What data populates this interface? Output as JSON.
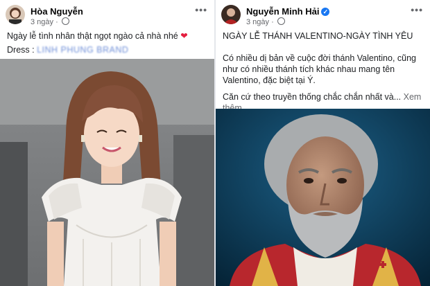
{
  "left_post": {
    "author": "Hòa Nguyễn",
    "time": "3 ngày",
    "visibility_icon": "globe-icon",
    "more_icon": "more-options-icon",
    "caption": "Ngày lễ tình nhân thật ngọt ngào cả nhà nhé",
    "caption_emoji": "❤",
    "dress_label": "Dress :",
    "dress_brand": "LINH PHUNG BRAND"
  },
  "right_post": {
    "author": "Nguyễn Minh Hải",
    "time": "3 ngày",
    "verified_icon": "verified-badge-icon",
    "verified_glyph": "✓",
    "visibility_icon": "globe-icon",
    "more_icon": "more-options-icon",
    "title": "NGÀY LỄ THÁNH VALENTINO-NGÀY TÌNH YÊU",
    "paragraph1": "Có nhiều dị bản về cuộc đời thánh Valentino, cũng như có nhiều thánh tích khác nhau mang tên Valentino, đặc biệt tại Ý.",
    "paragraph2": "Căn cứ theo truyền thống chắc chắn nhất và...",
    "see_more": "Xem thêm"
  },
  "colors": {
    "accent": "#1877f2",
    "heart": "#e41e3f",
    "muted": "#65676b"
  }
}
